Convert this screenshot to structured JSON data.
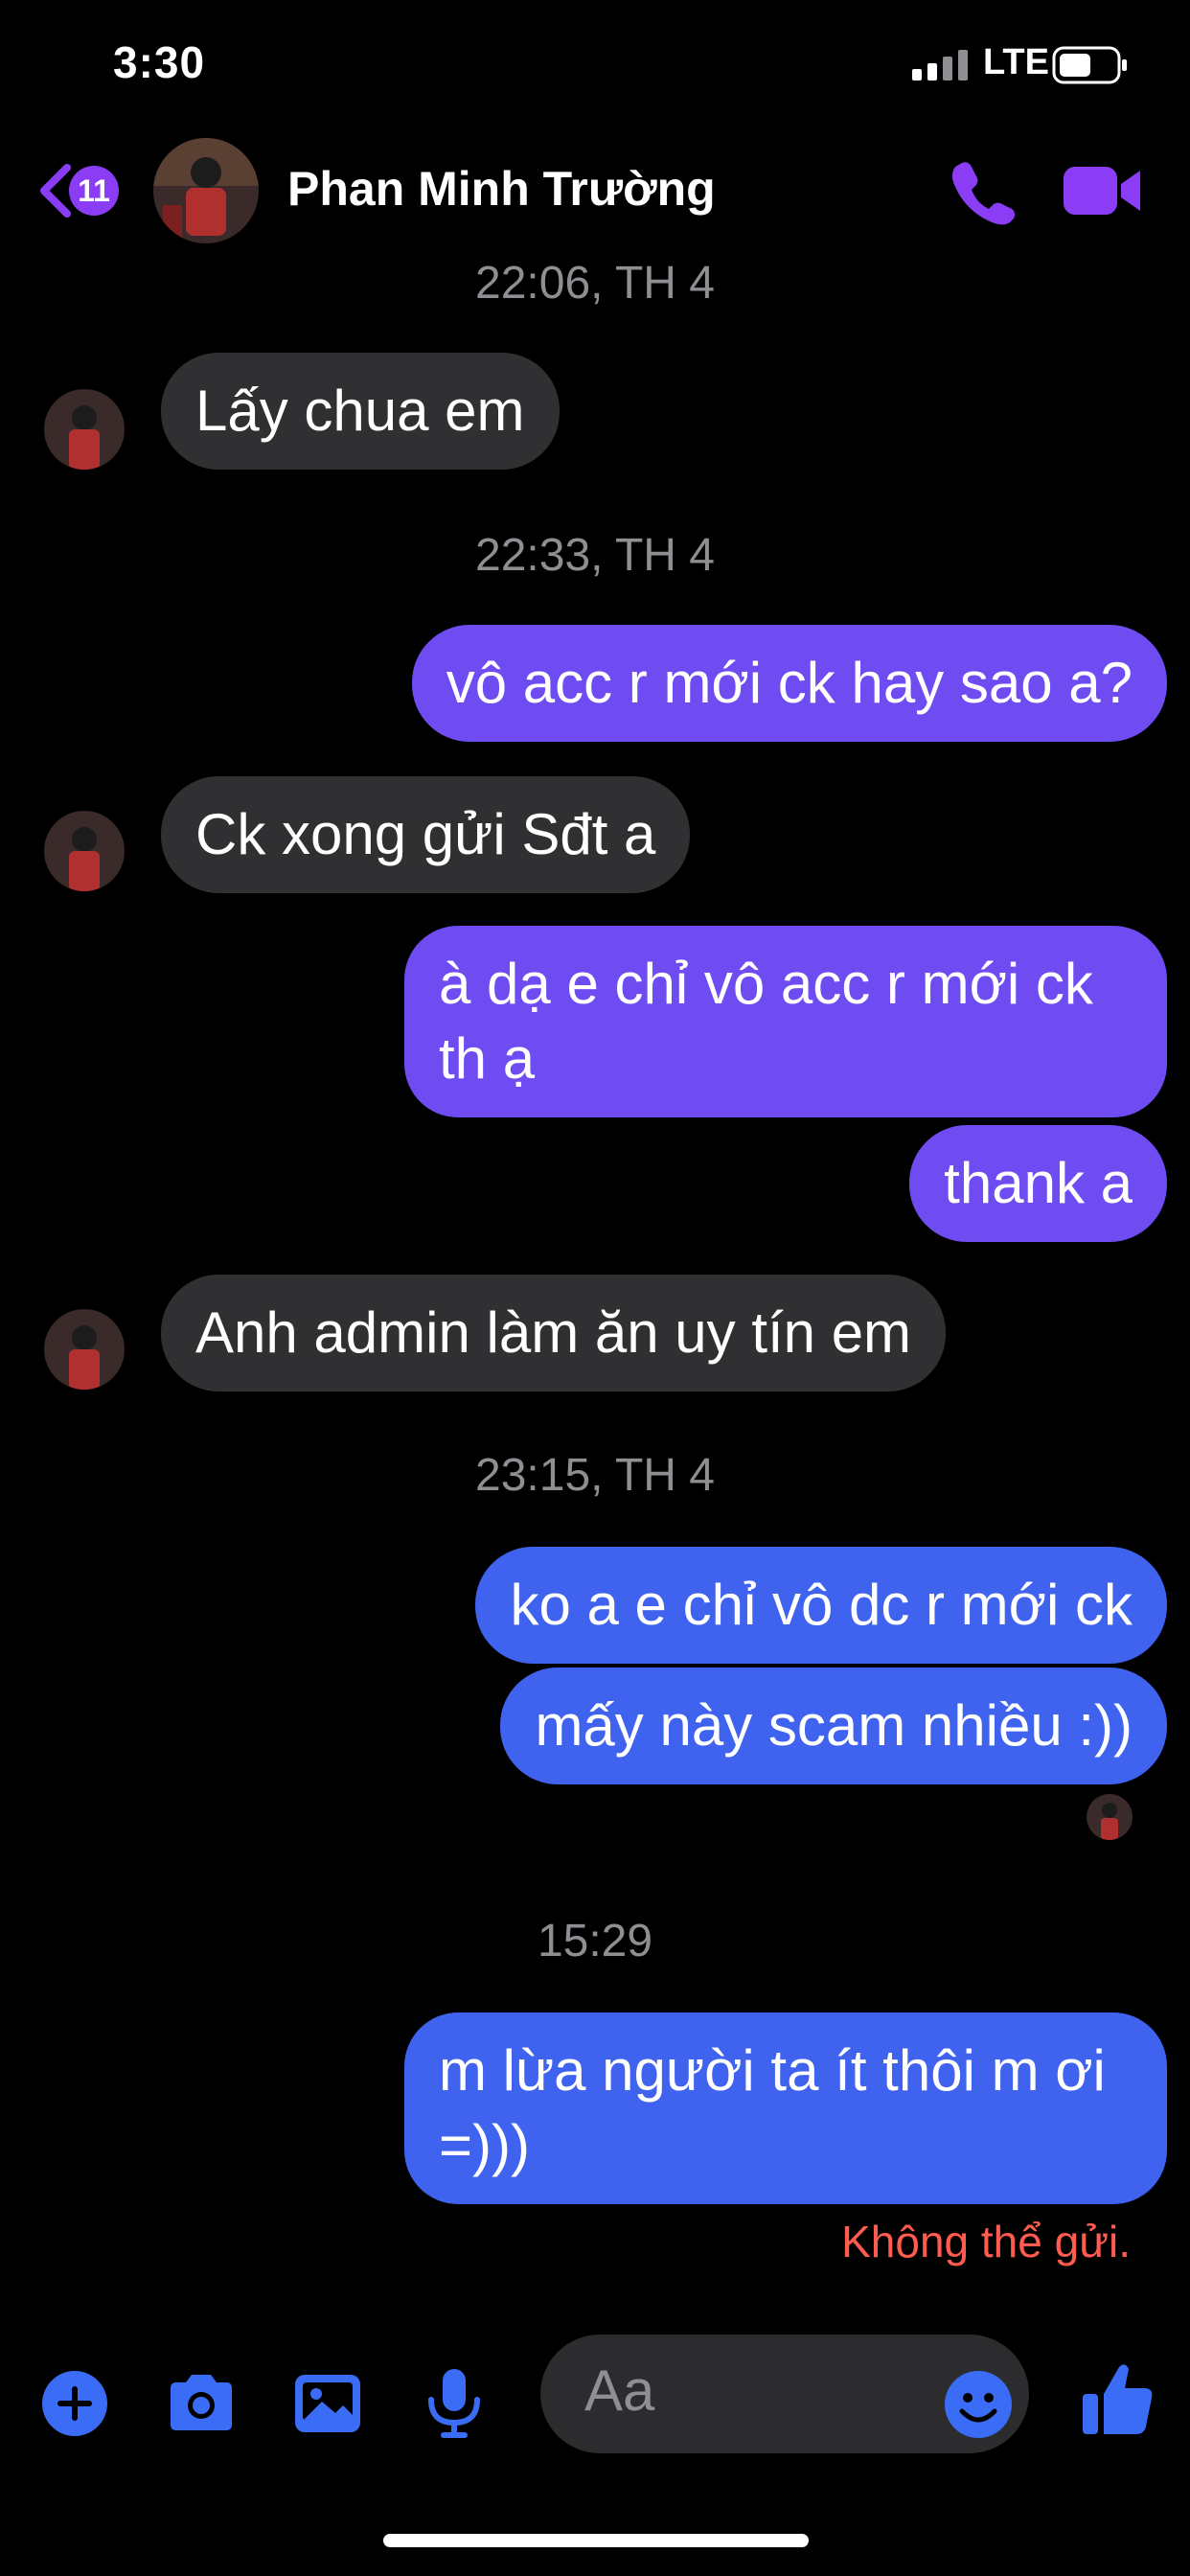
{
  "status_bar": {
    "time": "3:30",
    "network": "LTE"
  },
  "header": {
    "unread_count": "11",
    "contact_name": "Phan Minh Trường"
  },
  "messages": [
    {
      "type": "timestamp",
      "text": "22:06, TH 4"
    },
    {
      "type": "received",
      "text": "Lấy chua em"
    },
    {
      "type": "timestamp",
      "text": "22:33, TH 4"
    },
    {
      "type": "sent",
      "text": "vô acc r mới ck hay sao a?"
    },
    {
      "type": "received",
      "text": "Ck xong gửi Sđt a"
    },
    {
      "type": "sent",
      "text": "à dạ e chỉ vô acc r mới ck th ạ"
    },
    {
      "type": "sent",
      "text": "thank a"
    },
    {
      "type": "received",
      "text": "Anh admin làm ăn uy tín em"
    },
    {
      "type": "timestamp",
      "text": "23:15, TH 4"
    },
    {
      "type": "sent",
      "text": "ko a e chỉ vô dc r mới ck"
    },
    {
      "type": "sent",
      "text": "mấy này scam nhiều :))"
    },
    {
      "type": "timestamp",
      "text": "15:29"
    },
    {
      "type": "sent",
      "text": "m lừa người ta ít thôi m ơi =)))",
      "status": "Không thể gửi."
    }
  ],
  "composer": {
    "placeholder": "Aa",
    "icons": [
      "plus-icon",
      "camera-icon",
      "image-icon",
      "microphone-icon",
      "emoji-icon",
      "thumbs-up-icon"
    ]
  },
  "colors": {
    "accent": "#8a3df5",
    "sent_purple": "#6f4cf2",
    "sent_blue": "#3f63ef",
    "received": "#303033",
    "error": "#ff5b4f"
  }
}
